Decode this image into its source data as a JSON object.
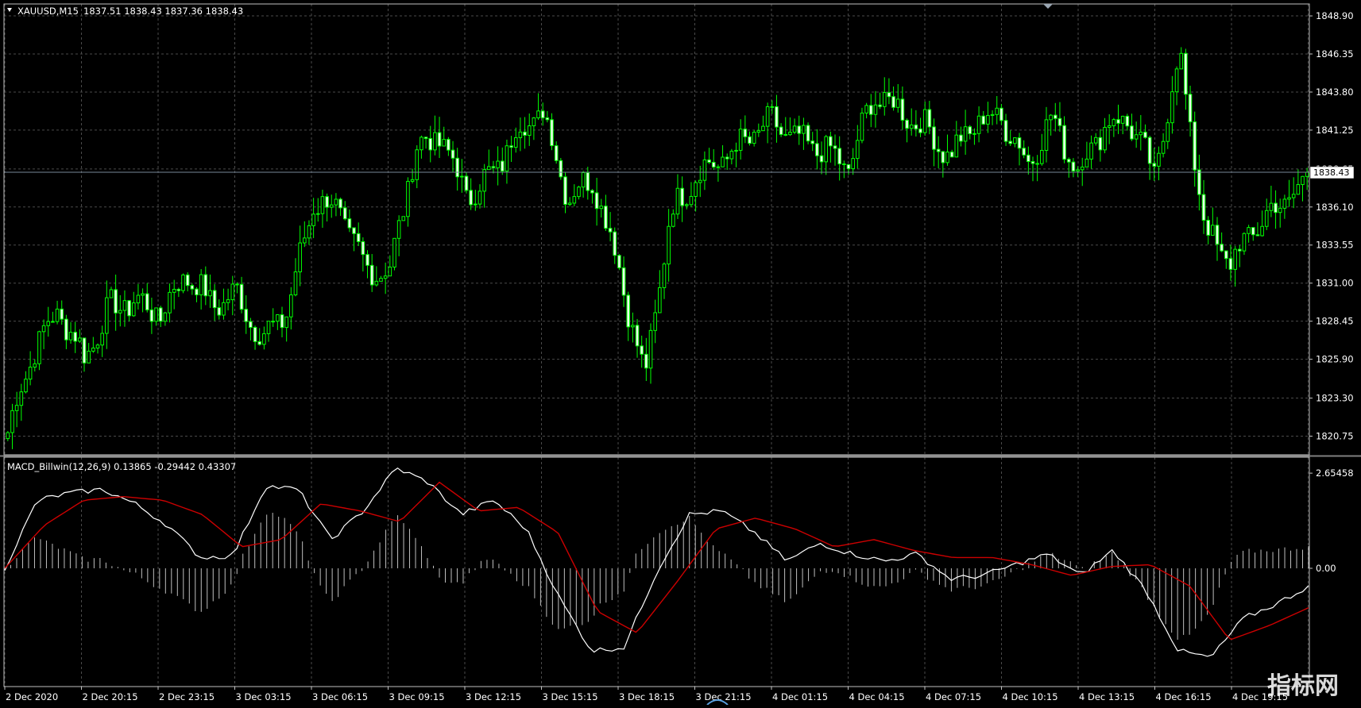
{
  "chart_window": {
    "header": {
      "symbol_timeframe": "XAUUSD,M15",
      "ohlc": "1837.51 1838.43 1837.36 1838.43"
    },
    "current_price_label": "1838.43",
    "indicator_header": "MACD_Billwin(12,26,9) 0.13865 -0.29442 0.43307",
    "colors": {
      "background": "#000000",
      "grid": "#4a4a4a",
      "candle": "#00ff00",
      "axis_text": "#ffffff",
      "macd_line": "#ffffff",
      "signal_line": "#cc0000",
      "histogram": "#bfbfbf",
      "bid_line": "#778899"
    },
    "watermark": "指标网"
  },
  "chart_data": [
    {
      "type": "candlestick",
      "symbol": "XAUUSD",
      "timeframe": "M15",
      "ylim": [
        1819.5,
        1849.7
      ],
      "y_ticks": [
        "1848.90",
        "1846.35",
        "1843.80",
        "1841.25",
        "1838.65",
        "1836.10",
        "1833.55",
        "1831.00",
        "1828.45",
        "1825.90",
        "1823.30",
        "1820.75"
      ],
      "x_ticks": [
        "2 Dec 2020",
        "2 Dec 20:15",
        "2 Dec 23:15",
        "3 Dec 03:15",
        "3 Dec 06:15",
        "3 Dec 09:15",
        "3 Dec 12:15",
        "3 Dec 15:15",
        "3 Dec 18:15",
        "3 Dec 21:15",
        "4 Dec 01:15",
        "4 Dec 04:15",
        "4 Dec 07:15",
        "4 Dec 10:15",
        "4 Dec 13:15",
        "4 Dec 16:15",
        "4 Dec 19:15"
      ],
      "close_path": [
        1821.0,
        1826.5,
        1829.2,
        1826.0,
        1829.3,
        1829.8,
        1828.9,
        1831.7,
        1829.6,
        1830.2,
        1827.2,
        1829.3,
        1836.5,
        1836.0,
        1832.0,
        1831.8,
        1840.0,
        1840.8,
        1836.9,
        1838.2,
        1841.2,
        1842.5,
        1836.8,
        1838.0,
        1832.0,
        1824.5,
        1835.5,
        1838.3,
        1839.2,
        1840.6,
        1841.8,
        1840.5,
        1840.0,
        1838.7,
        1843.6,
        1842.6,
        1841.4,
        1839.5,
        1841.8,
        1842.2,
        1839.0,
        1842.0,
        1838.5,
        1841.5,
        1842.0,
        1838.2,
        1846.4,
        1834.5,
        1832.4,
        1834.8,
        1836.4,
        1837.7
      ],
      "last_price": 1838.43
    },
    {
      "type": "macd",
      "name": "MACD_Billwin(12,26,9)",
      "values": {
        "main": 0.13865,
        "signal": -0.29442,
        "histogram": 0.43307
      },
      "ylim": [
        -3.3,
        3.1
      ],
      "y_ticks": [
        "2.65458",
        "0.00"
      ],
      "macd_path": [
        0.0,
        1.9,
        2.1,
        2.2,
        1.8,
        1.2,
        0.3,
        0.35,
        2.3,
        2.2,
        0.8,
        1.6,
        2.8,
        2.4,
        1.5,
        1.9,
        1.1,
        -0.8,
        -2.3,
        -2.2,
        -0.1,
        1.5,
        1.6,
        1.0,
        0.2,
        0.7,
        0.4,
        0.2,
        0.4,
        -0.3,
        -0.2,
        0.1,
        0.4,
        -0.2,
        0.5,
        -0.6,
        -2.3,
        -2.5,
        -1.4,
        -1.0,
        -0.5
      ],
      "signal_path": [
        0.0,
        1.2,
        1.9,
        2.0,
        1.9,
        1.5,
        0.6,
        0.8,
        1.8,
        1.6,
        1.3,
        2.4,
        1.6,
        1.7,
        1.0,
        -1.2,
        -1.8,
        -0.4,
        1.1,
        1.4,
        1.1,
        0.6,
        0.8,
        0.5,
        0.3,
        0.3,
        0.1,
        -0.2,
        0.05,
        0.1,
        -0.5,
        -2.0,
        -1.6,
        -1.1
      ]
    }
  ]
}
